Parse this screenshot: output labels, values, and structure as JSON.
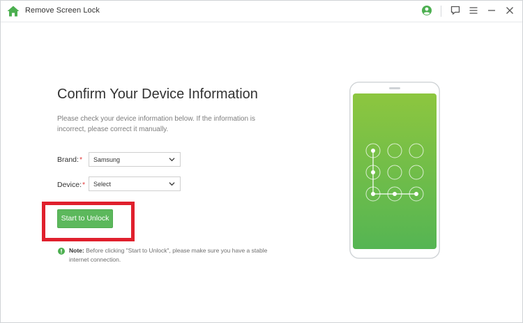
{
  "titlebar": {
    "app_title": "Remove Screen Lock",
    "icons": [
      "home-icon",
      "account-icon",
      "feedback-icon",
      "menu-icon",
      "minimize-icon",
      "close-icon"
    ]
  },
  "main": {
    "title": "Confirm Your Device Information",
    "description": "Please check your device information below. If the information is incorrect, please correct it manually.",
    "brand": {
      "label": "Brand:",
      "required_mark": "*",
      "selected": "Samsung"
    },
    "device": {
      "label": "Device:",
      "required_mark": "*",
      "selected": "Select"
    },
    "start_button_label": "Start to Unlock",
    "note": {
      "prefix": "Note:",
      "text": " Before clicking \"Start to Unlock\", please make sure you have a stable internet connection."
    }
  },
  "colors": {
    "accent_green": "#5cb85c",
    "highlight_red": "#e0202d",
    "required_red": "#e03a3a",
    "phone_gradient_top": "#8dc63f",
    "phone_gradient_bottom": "#55b553"
  }
}
